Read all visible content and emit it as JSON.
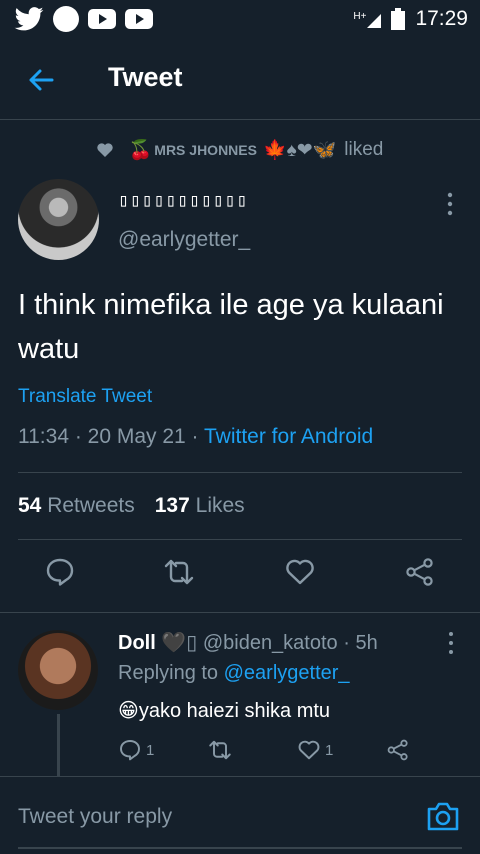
{
  "statusbar": {
    "icons": [
      "twitter-bird-icon",
      "circle-icon",
      "youtube-icon",
      "youtube-icon"
    ],
    "network": "H+",
    "time": "17:29"
  },
  "appbar": {
    "title": "Tweet"
  },
  "liked": {
    "name": "MRS JHONNES",
    "name_prefix_emoji": "🍒",
    "name_suffix_emojis": "🍁♠❤🦋",
    "action": "liked"
  },
  "tweet": {
    "author_name": "▯▯▯▯▯▯▯▯▯▯▯",
    "handle": "@earlygetter_",
    "text": "I think nimefika ile age ya kulaani watu",
    "translate": "Translate Tweet",
    "time": "11:34 · 20 May 21 · ",
    "client": "Twitter for Android",
    "retweets": "54",
    "retweets_label": "Retweets",
    "likes": "137",
    "likes_label": "Likes"
  },
  "reply": {
    "name": "Doll",
    "name_emoji": "🖤▯",
    "handle_time": " @biden_katoto · 5h",
    "replying_label": "Replying to ",
    "replying_handle": "@earlygetter_",
    "text": "😁yako haiezi shika mtu",
    "reply_count": "1",
    "like_count": "1"
  },
  "composer": {
    "placeholder": "Tweet your reply"
  },
  "colors": {
    "background": "#15202b",
    "accent": "#1da1f2",
    "muted": "#8899a6",
    "divider": "#38444d"
  }
}
